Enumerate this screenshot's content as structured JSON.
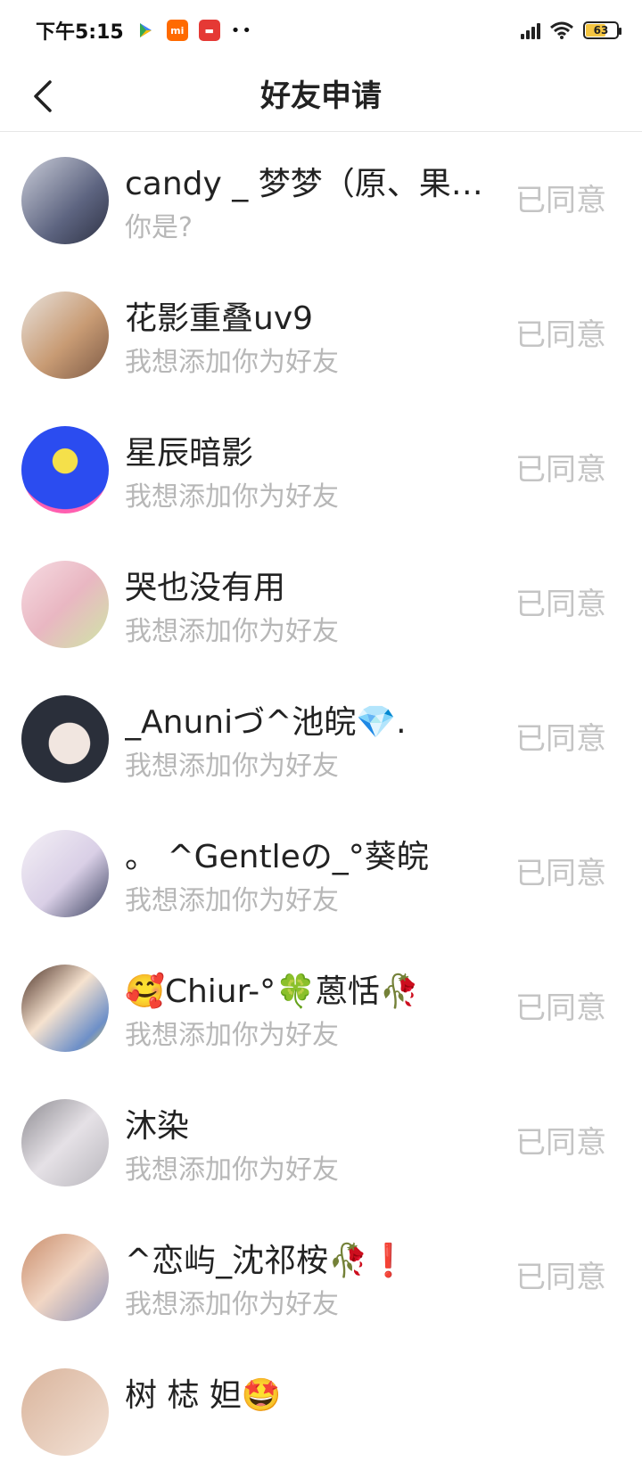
{
  "status_bar": {
    "time": "下午5:15",
    "apps": [
      "play-store-icon",
      "mi-app-icon",
      "red-app-icon"
    ],
    "battery": "63"
  },
  "nav": {
    "title": "好友申请"
  },
  "requests": [
    {
      "name": "candy _ 梦梦（原、果…",
      "message": "你是?",
      "status": "已同意",
      "avatar_color": "#8a8fa6"
    },
    {
      "name": "花影重叠uv9",
      "message": "我想添加你为好友",
      "status": "已同意",
      "avatar_color": "#c89b74"
    },
    {
      "name": "星辰暗影",
      "message": "我想添加你为好友",
      "status": "已同意",
      "avatar_color": "#2b4cf0"
    },
    {
      "name": "哭也没有用",
      "message": "我想添加你为好友",
      "status": "已同意",
      "avatar_color": "#e9b7c2"
    },
    {
      "name": "_Anuniづ^池皖💎.",
      "message": "我想添加你为好友",
      "status": "已同意",
      "avatar_color": "#2a2f3a"
    },
    {
      "name": "。 ^Gentleの_°葵皖",
      "message": "我想添加你为好友",
      "status": "已同意",
      "avatar_color": "#e6e1ec"
    },
    {
      "name": "🥰Chiur-°🍀蒽恬🥀",
      "message": "我想添加你为好友",
      "status": "已同意",
      "avatar_color": "#6b4a3a"
    },
    {
      "name": "沐染",
      "message": "我想添加你为好友",
      "status": "已同意",
      "avatar_color": "#b8b6bc"
    },
    {
      "name": "^恋屿_沈祁桉🥀❗",
      "message": "我想添加你为好友",
      "status": "已同意",
      "avatar_color": "#d4a58a"
    },
    {
      "name": "树 梽 妲🤩",
      "message": "",
      "status": "",
      "avatar_color": "#d9b49c"
    }
  ]
}
